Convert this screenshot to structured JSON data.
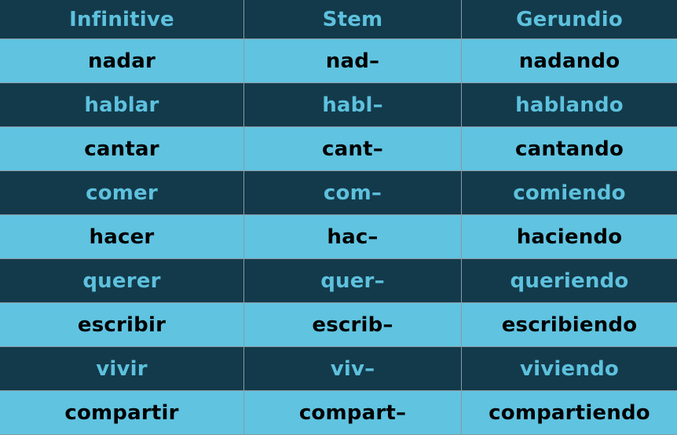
{
  "table": {
    "headers": [
      "Infinitive",
      "Stem",
      "Gerundio"
    ],
    "rows": [
      [
        "nadar",
        "nad–",
        "nadando"
      ],
      [
        "hablar",
        "habl–",
        "hablando"
      ],
      [
        "cantar",
        "cant–",
        "cantando"
      ],
      [
        "comer",
        "com–",
        "comiendo"
      ],
      [
        "hacer",
        "hac–",
        "haciendo"
      ],
      [
        "querer",
        "quer–",
        "queriendo"
      ],
      [
        "escribir",
        "escrib–",
        "escribiendo"
      ],
      [
        "vivir",
        "viv–",
        "viviendo"
      ],
      [
        "compartir",
        "compart–",
        "compartiendo"
      ]
    ]
  },
  "colors": {
    "dark_row_bg": "#133a4b",
    "dark_row_text": "#5dc1dd",
    "light_row_bg": "#60c3e0",
    "light_row_text": "#000000"
  }
}
